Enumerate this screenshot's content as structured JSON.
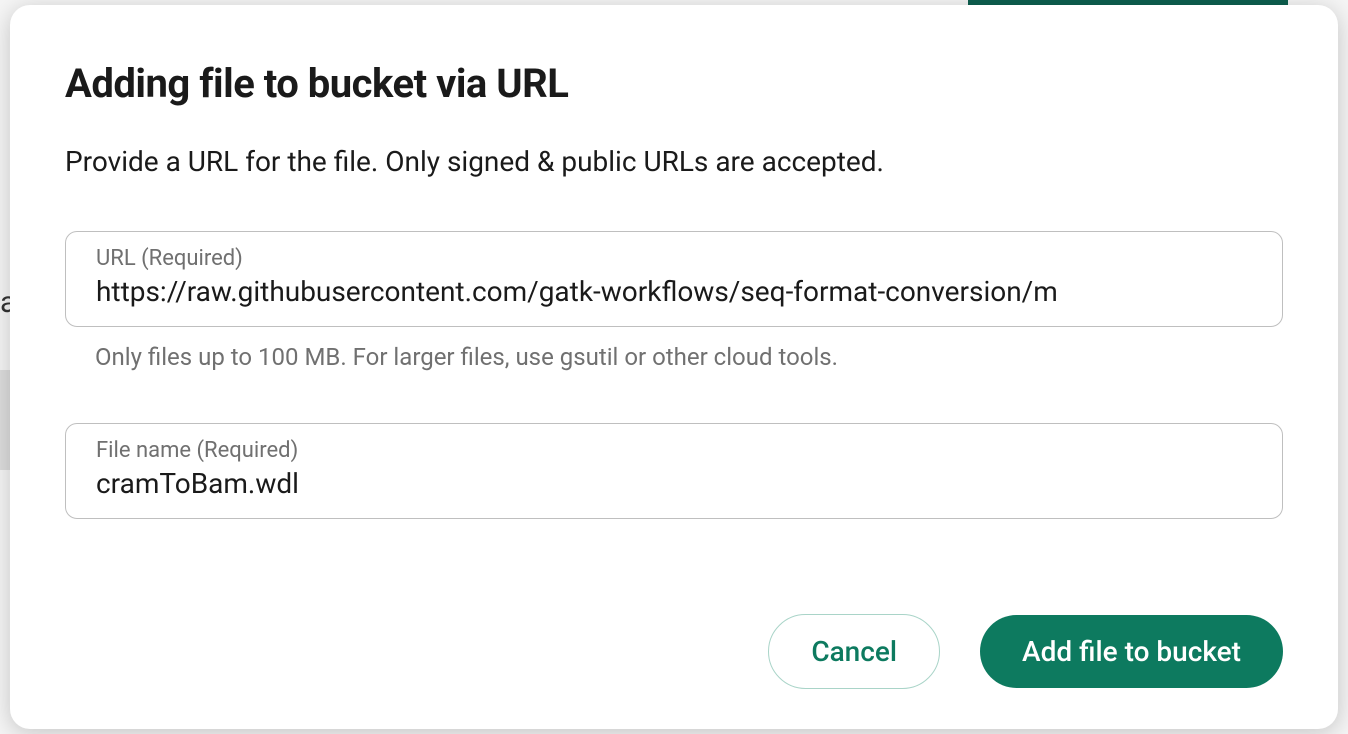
{
  "modal": {
    "title": "Adding file to bucket via URL",
    "description": "Provide a URL for the file. Only signed & public URLs are accepted.",
    "url_field": {
      "label": "URL (Required)",
      "value": "https://raw.githubusercontent.com/gatk-workflows/seq-format-conversion/m",
      "helper": "Only files up to 100 MB. For larger files, use gsutil or other cloud tools."
    },
    "filename_field": {
      "label": "File name (Required)",
      "value": "cramToBam.wdl"
    },
    "buttons": {
      "cancel": "Cancel",
      "submit": "Add file to bucket"
    }
  },
  "background": {
    "letter": "a"
  }
}
